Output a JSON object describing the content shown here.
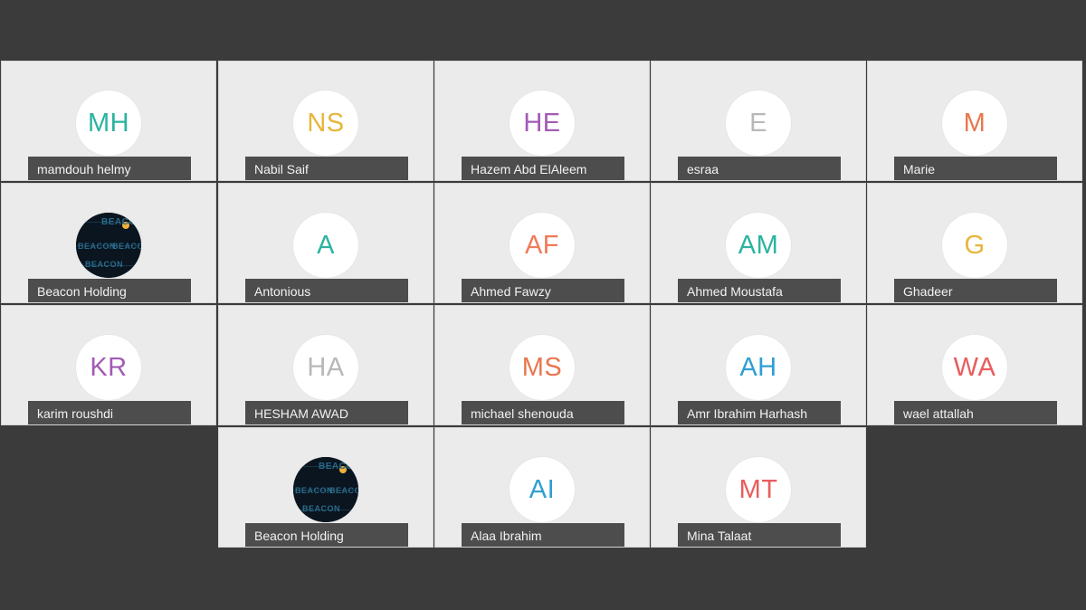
{
  "participants": [
    {
      "initials": "MH",
      "name": "mamdouh helmy",
      "color": "#2bb3a0",
      "avatar": "initials"
    },
    {
      "initials": "NS",
      "name": "Nabil Saif",
      "color": "#e8b53a",
      "avatar": "initials"
    },
    {
      "initials": "HE",
      "name": "Hazem Abd ElAleem",
      "color": "#a25bb5",
      "avatar": "initials"
    },
    {
      "initials": "E",
      "name": "esraa",
      "color": "#b8b8b8",
      "avatar": "initials"
    },
    {
      "initials": "M",
      "name": "Marie",
      "color": "#e8774e",
      "avatar": "initials"
    },
    {
      "initials": "",
      "name": "Beacon Holding",
      "color": "#0b1a25",
      "avatar": "logo",
      "logo_text": "BEACON"
    },
    {
      "initials": "A",
      "name": "Antonious",
      "color": "#2bb3a0",
      "avatar": "initials"
    },
    {
      "initials": "AF",
      "name": "Ahmed Fawzy",
      "color": "#ef7a57",
      "avatar": "initials"
    },
    {
      "initials": "AM",
      "name": "Ahmed Moustafa",
      "color": "#2bb3a0",
      "avatar": "initials"
    },
    {
      "initials": "G",
      "name": "Ghadeer",
      "color": "#e8b53a",
      "avatar": "initials"
    },
    {
      "initials": "KR",
      "name": "karim roushdi",
      "color": "#a25bb5",
      "avatar": "initials"
    },
    {
      "initials": "HA",
      "name": "HESHAM AWAD",
      "color": "#b8b8b8",
      "avatar": "initials"
    },
    {
      "initials": "MS",
      "name": "michael shenouda",
      "color": "#e8774e",
      "avatar": "initials"
    },
    {
      "initials": "AH",
      "name": "Amr Ibrahim Harhash",
      "color": "#2f9fd3",
      "avatar": "initials"
    },
    {
      "initials": "WA",
      "name": "wael attallah",
      "color": "#e85d5d",
      "avatar": "initials"
    },
    {
      "initials": "",
      "name": "Beacon Holding",
      "color": "#0b1a25",
      "avatar": "logo",
      "logo_text": "BEACON"
    },
    {
      "initials": "AI",
      "name": "Alaa Ibrahim",
      "color": "#2f9fd3",
      "avatar": "initials"
    },
    {
      "initials": "MT",
      "name": "Mina Talaat",
      "color": "#e85d5d",
      "avatar": "initials"
    }
  ]
}
